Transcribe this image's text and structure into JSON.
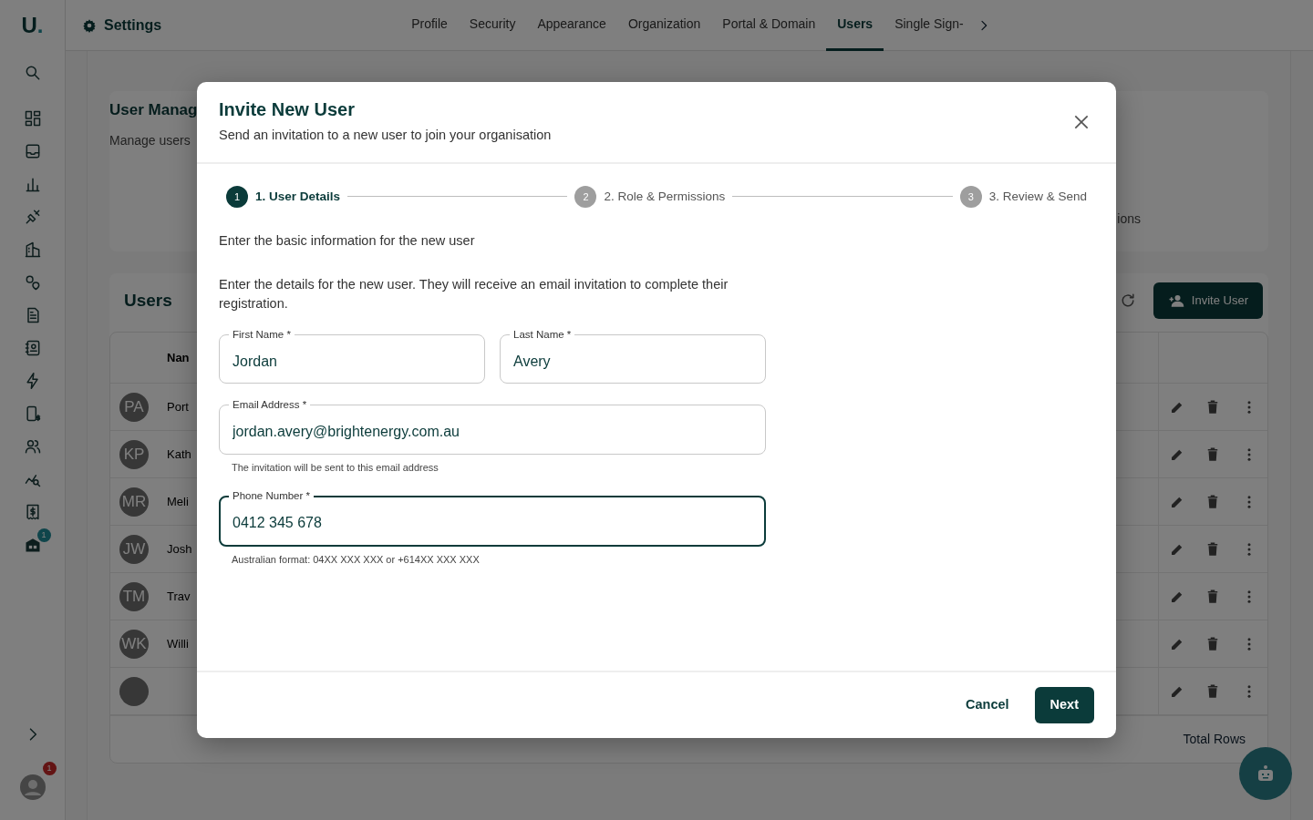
{
  "sidebar": {
    "logo_letter": "U",
    "logo_dot": ".",
    "nav_badge": "1",
    "account_badge": "1"
  },
  "topbar": {
    "title": "Settings",
    "tabs": [
      {
        "label": "Profile",
        "selected": false
      },
      {
        "label": "Security",
        "selected": false
      },
      {
        "label": "Appearance",
        "selected": false
      },
      {
        "label": "Organization",
        "selected": false
      },
      {
        "label": "Portal & Domain",
        "selected": false
      },
      {
        "label": "Users",
        "selected": true
      },
      {
        "label": "Single Sign-",
        "selected": false
      }
    ]
  },
  "page_header": {
    "title": "User Manag",
    "subtitle": "Manage users",
    "side_text": "ions"
  },
  "users": {
    "title": "Users",
    "invite_button": "Invite User",
    "columns": [
      "Nan"
    ],
    "rows": [
      {
        "kind": "user",
        "initials": "PA",
        "name": "Port"
      },
      {
        "kind": "user",
        "initials": "KP",
        "name": "Kath"
      },
      {
        "kind": "user",
        "initials": "MR",
        "name": "Meli"
      },
      {
        "kind": "user",
        "initials": "JW",
        "name": "Josh"
      },
      {
        "kind": "user",
        "initials": "TM",
        "name": "Trav"
      },
      {
        "kind": "user",
        "initials": "WK",
        "name": "Willi"
      },
      {
        "kind": "empty"
      }
    ],
    "footer": "Total Rows"
  },
  "modal": {
    "title": "Invite New User",
    "subtitle": "Send an invitation to a new user to join your organisation",
    "steps": [
      {
        "number": "1",
        "label": "1. User Details",
        "selected": true
      },
      {
        "number": "2",
        "label": "2. Role & Permissions",
        "selected": false
      },
      {
        "number": "3",
        "label": "3. Review & Send",
        "selected": false
      }
    ],
    "intro": "Enter the basic information for the new user",
    "description": "Enter the details for the new user. They will receive an email invitation to complete their registration.",
    "fields": [
      {
        "label": "First Name *",
        "value": "Jordan",
        "focused": false
      },
      {
        "label": "Last Name *",
        "value": "Avery",
        "focused": false
      },
      {
        "label": "Email Address *",
        "value": "jordan.avery@brightenergy.com.au",
        "helper": "The invitation will be sent to this email address",
        "focused": false
      },
      {
        "label": "Phone Number *",
        "value": "0412 345 678",
        "helper": "Australian format: 04XX XXX XXX or +614XX XXX XXX",
        "focused": true
      }
    ],
    "cancel_button": "Cancel",
    "next_button": "Next"
  }
}
